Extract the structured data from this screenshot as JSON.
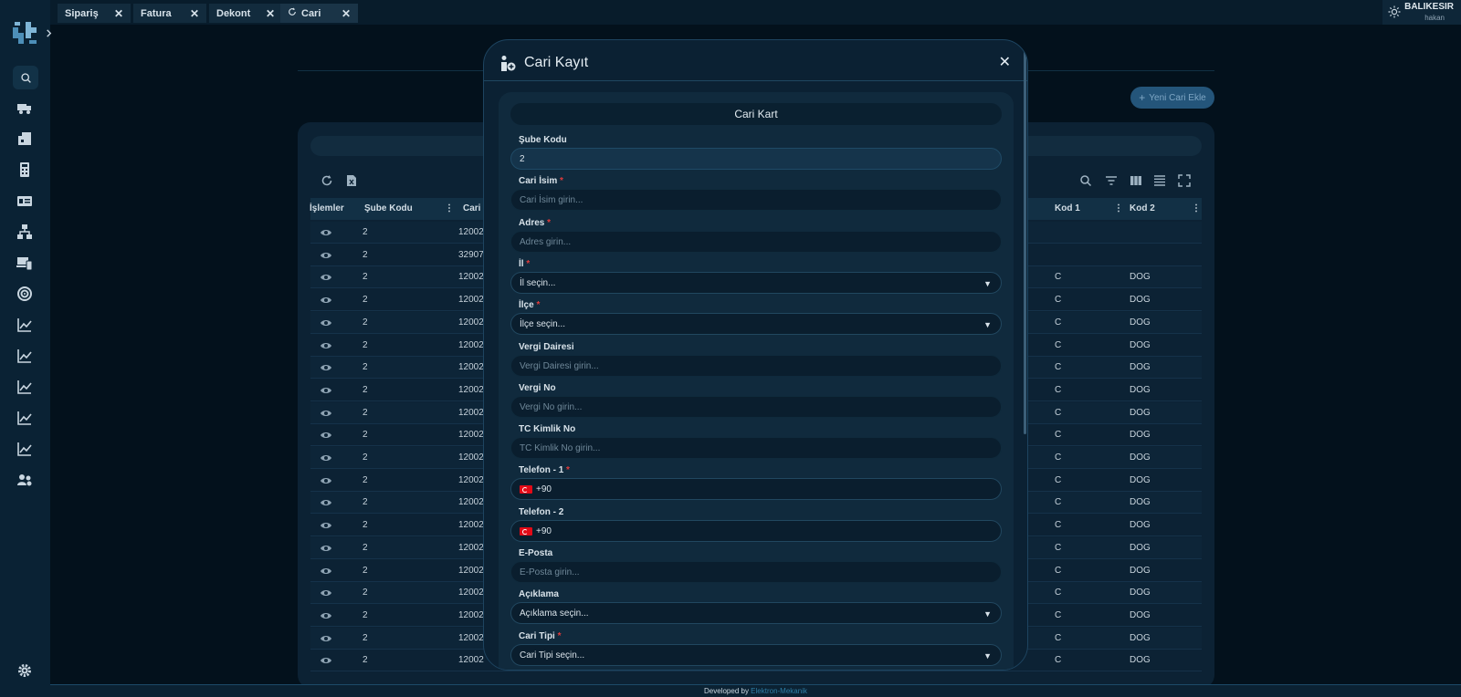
{
  "tabs": [
    {
      "label": "Sipariş",
      "active": false
    },
    {
      "label": "Fatura",
      "active": false
    },
    {
      "label": "Dekont",
      "active": false
    },
    {
      "label": "Cari",
      "active": true
    }
  ],
  "user": {
    "branch": "BALIKESIR",
    "name": "hakan"
  },
  "background_page": {
    "add_button": "Yeni Cari Ekle",
    "table": {
      "columns": [
        "İşlemler",
        "Şube Kodu",
        "Cari İ",
        "Kod 1",
        "Kod 2"
      ],
      "rows": [
        {
          "sube": "2",
          "cari": "12002",
          "kod1": "",
          "kod2": ""
        },
        {
          "sube": "2",
          "cari": "32907",
          "kod1": "",
          "kod2": ""
        },
        {
          "sube": "2",
          "cari": "12002",
          "kod1": "C",
          "kod2": "DOG"
        },
        {
          "sube": "2",
          "cari": "12002",
          "kod1": "C",
          "kod2": "DOG"
        },
        {
          "sube": "2",
          "cari": "12002",
          "kod1": "C",
          "kod2": "DOG"
        },
        {
          "sube": "2",
          "cari": "12002",
          "kod1": "C",
          "kod2": "DOG"
        },
        {
          "sube": "2",
          "cari": "12002",
          "kod1": "C",
          "kod2": "DOG"
        },
        {
          "sube": "2",
          "cari": "12002",
          "kod1": "C",
          "kod2": "DOG"
        },
        {
          "sube": "2",
          "cari": "12002",
          "kod1": "C",
          "kod2": "DOG"
        },
        {
          "sube": "2",
          "cari": "12002",
          "kod1": "C",
          "kod2": "DOG"
        },
        {
          "sube": "2",
          "cari": "12002",
          "kod1": "C",
          "kod2": "DOG"
        },
        {
          "sube": "2",
          "cari": "12002",
          "kod1": "C",
          "kod2": "DOG"
        },
        {
          "sube": "2",
          "cari": "12002",
          "kod1": "C",
          "kod2": "DOG"
        },
        {
          "sube": "2",
          "cari": "12002",
          "kod1": "C",
          "kod2": "DOG"
        },
        {
          "sube": "2",
          "cari": "12002",
          "kod1": "C",
          "kod2": "DOG"
        },
        {
          "sube": "2",
          "cari": "12002",
          "kod1": "C",
          "kod2": "DOG"
        },
        {
          "sube": "2",
          "cari": "12002",
          "kod1": "C",
          "kod2": "DOG"
        },
        {
          "sube": "2",
          "cari": "12002",
          "kod1": "C",
          "kod2": "DOG"
        },
        {
          "sube": "2",
          "cari": "12002",
          "kod1": "C",
          "kod2": "DOG"
        },
        {
          "sube": "2",
          "cari": "12002",
          "kod1": "C",
          "kod2": "DOG"
        }
      ]
    }
  },
  "modal": {
    "title": "Cari Kayıt",
    "card_title": "Cari Kart",
    "fields": [
      {
        "label": "Şube Kodu",
        "required": false,
        "type": "text",
        "value": "2",
        "placeholder": ""
      },
      {
        "label": "Cari İsim",
        "required": true,
        "type": "text",
        "value": "",
        "placeholder": "Cari İsim girin..."
      },
      {
        "label": "Adres",
        "required": true,
        "type": "text",
        "value": "",
        "placeholder": "Adres girin..."
      },
      {
        "label": "İl",
        "required": true,
        "type": "select",
        "value": "İl seçin...",
        "placeholder": ""
      },
      {
        "label": "İlçe",
        "required": true,
        "type": "select",
        "value": "İlçe seçin...",
        "placeholder": ""
      },
      {
        "label": "Vergi Dairesi",
        "required": false,
        "type": "text",
        "value": "",
        "placeholder": "Vergi Dairesi girin..."
      },
      {
        "label": "Vergi No",
        "required": false,
        "type": "text",
        "value": "",
        "placeholder": "Vergi No girin..."
      },
      {
        "label": "TC Kimlik No",
        "required": false,
        "type": "text",
        "value": "",
        "placeholder": "TC Kimlik No girin..."
      },
      {
        "label": "Telefon - 1",
        "required": true,
        "type": "phone",
        "value": "+90",
        "placeholder": ""
      },
      {
        "label": "Telefon - 2",
        "required": false,
        "type": "phone",
        "value": "+90",
        "placeholder": ""
      },
      {
        "label": "E-Posta",
        "required": false,
        "type": "text",
        "value": "",
        "placeholder": "E-Posta girin..."
      },
      {
        "label": "Açıklama",
        "required": false,
        "type": "select",
        "value": "Açıklama seçin...",
        "placeholder": ""
      },
      {
        "label": "Cari Tipi",
        "required": true,
        "type": "select",
        "value": "Cari Tipi seçin...",
        "placeholder": ""
      }
    ]
  },
  "footer": {
    "prefix": "Developed by",
    "link": "Elektron-Mekanik"
  },
  "colors": {
    "accent": "#24557a",
    "required": "#e03b3b",
    "link": "#2f7fa7"
  }
}
